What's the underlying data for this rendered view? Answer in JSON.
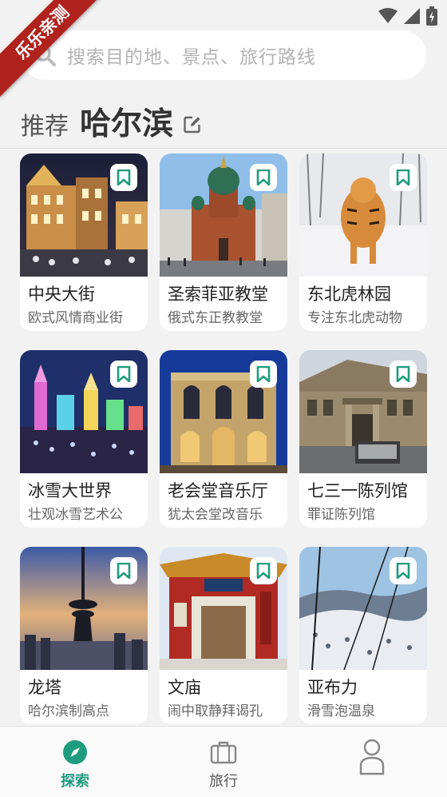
{
  "badge": {
    "text": "乐乐亲测"
  },
  "status_bar": {
    "icons": [
      "wifi-icon",
      "signal-icon",
      "battery-charging-icon"
    ]
  },
  "search": {
    "placeholder": "搜索目的地、景点、旅行路线"
  },
  "heading": {
    "prefix": "推荐",
    "city": "哈尔滨"
  },
  "colors": {
    "accent": "#1e9c7e",
    "background": "#f2f2f2",
    "ribbon": "#b0221c"
  },
  "places": [
    {
      "title": "中央大街",
      "subtitle": "欧式风情商业街",
      "bookmark_icon": "bookmark-icon"
    },
    {
      "title": "圣索菲亚教堂",
      "subtitle": "俄式东正教教堂",
      "bookmark_icon": "bookmark-icon"
    },
    {
      "title": "东北虎林园",
      "subtitle": "专注东北虎动物",
      "bookmark_icon": "bookmark-icon"
    },
    {
      "title": "冰雪大世界",
      "subtitle": "壮观冰雪艺术公",
      "bookmark_icon": "bookmark-icon"
    },
    {
      "title": "老会堂音乐厅",
      "subtitle": "犹太会堂改音乐",
      "bookmark_icon": "bookmark-icon"
    },
    {
      "title": "七三一陈列馆",
      "subtitle": "罪证陈列馆",
      "bookmark_icon": "bookmark-icon"
    },
    {
      "title": "龙塔",
      "subtitle": "哈尔滨制高点",
      "bookmark_icon": "bookmark-icon"
    },
    {
      "title": "文庙",
      "subtitle": "闹中取静拜谒孔",
      "bookmark_icon": "bookmark-icon"
    },
    {
      "title": "亚布力",
      "subtitle": "滑雪泡温泉",
      "bookmark_icon": "bookmark-icon"
    }
  ],
  "nav": {
    "items": [
      {
        "label": "探索",
        "icon": "compass-icon",
        "active": true
      },
      {
        "label": "旅行",
        "icon": "suitcase-icon",
        "active": false
      },
      {
        "label": "",
        "icon": "profile-icon",
        "active": false
      }
    ]
  }
}
